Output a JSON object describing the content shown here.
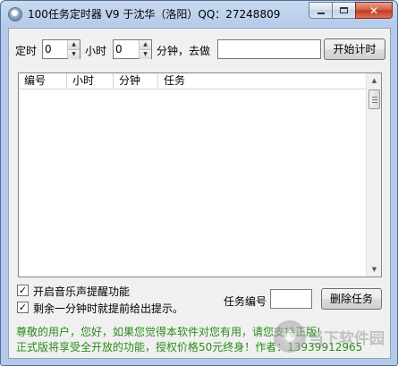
{
  "window": {
    "title": "100任务定时器 V9  于沈华（洛阳）QQ：27248809"
  },
  "timer": {
    "label_prefix": "定时",
    "hours_value": "0",
    "label_hours": "小时",
    "minutes_value": "0",
    "label_minutes": "分钟，去做",
    "task_value": "",
    "start_button": "开始计时"
  },
  "task_list": {
    "columns": [
      "编号",
      "小时",
      "分钟",
      "任务"
    ],
    "rows": []
  },
  "options": {
    "music_alert": {
      "label": "开启音乐声提醒功能",
      "checked": true
    },
    "one_minute_warning": {
      "label": "剩余一分钟时就提前给出提示。",
      "checked": true
    }
  },
  "delete_task": {
    "label": "任务编号",
    "value": "",
    "button": "删除任务"
  },
  "notice": {
    "line1": "尊敬的用户，您好，如果您觉得本软件对您有用，请您支持正版!",
    "line2": "正式版将享受全开放的功能，授权价格50元终身！作者：13939912965"
  },
  "watermark": {
    "text": "当下软件园"
  },
  "icons": {
    "app": "clock-icon",
    "minimize": "minimize-icon",
    "maximize": "maximize-icon",
    "close": "close-icon",
    "spin_up": "arrow-up-icon",
    "spin_down": "arrow-down-icon",
    "check": "checkmark-icon"
  },
  "colors": {
    "notice_text": "#2a8a1a",
    "close_button": "#c4371f",
    "title_bar": "#b4cae8"
  }
}
